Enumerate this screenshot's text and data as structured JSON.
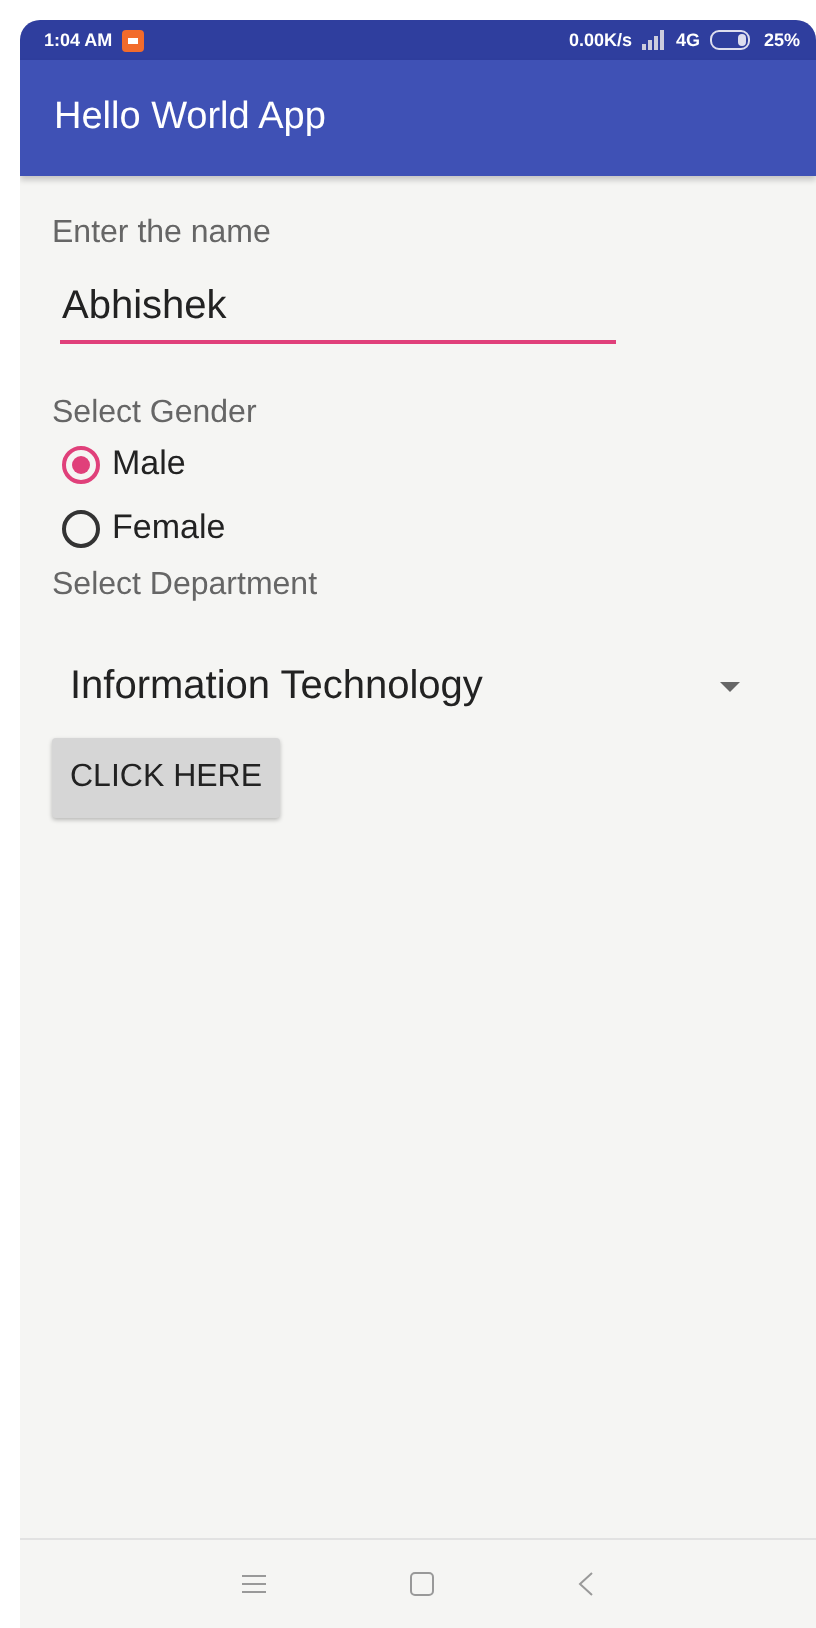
{
  "status_bar": {
    "time": "1:04 AM",
    "speed": "0.00K/s",
    "network": "4G",
    "battery": "25%"
  },
  "app_bar": {
    "title": "Hello World App"
  },
  "name_field": {
    "label": "Enter the name",
    "value": "Abhishek"
  },
  "gender": {
    "label": "Select Gender",
    "options": [
      {
        "label": "Male",
        "selected": true
      },
      {
        "label": "Female",
        "selected": false
      }
    ]
  },
  "department": {
    "label": "Select Department",
    "value": "Information Technology"
  },
  "button": {
    "label": "CLICK HERE"
  }
}
